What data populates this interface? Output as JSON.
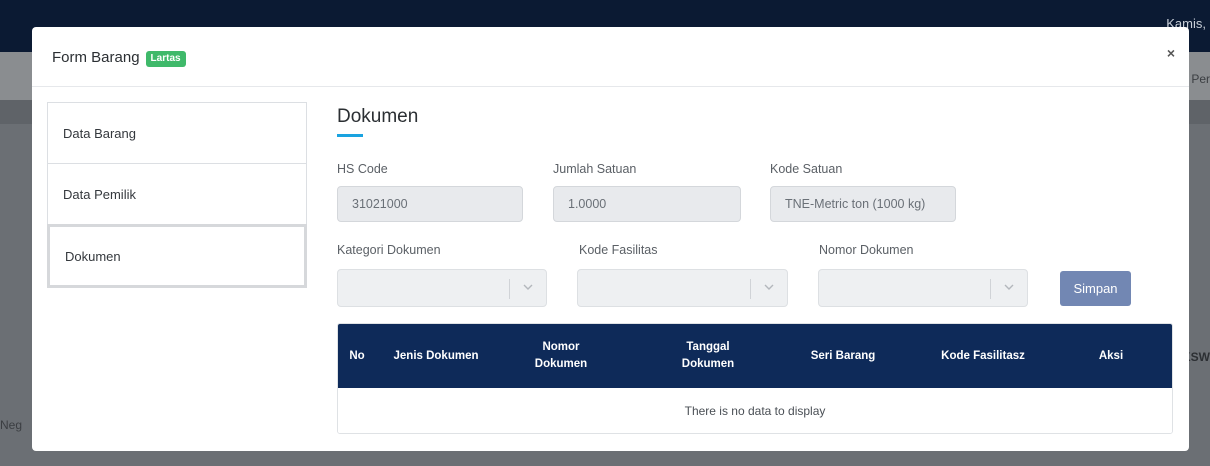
{
  "background": {
    "topbar_text": "Kamis,",
    "subbar_text": "Per",
    "right_side_text": "KSW",
    "left_side_text": "Neg"
  },
  "modal": {
    "title": "Form Barang",
    "badge": "Lartas",
    "close": "×"
  },
  "nav": {
    "items": [
      {
        "label": "Data Barang"
      },
      {
        "label": "Data Pemilik"
      },
      {
        "label": "Dokumen"
      }
    ],
    "active": "Dokumen"
  },
  "section": {
    "title": "Dokumen"
  },
  "fields": {
    "hs_code": {
      "label": "HS Code",
      "value": "31021000"
    },
    "jumlah_satuan": {
      "label": "Jumlah Satuan",
      "value": "1.0000"
    },
    "kode_satuan": {
      "label": "Kode Satuan",
      "value": "TNE-Metric ton (1000 kg)"
    },
    "kategori_dokumen": {
      "label": "Kategori Dokumen",
      "value": ""
    },
    "kode_fasilitas": {
      "label": "Kode Fasilitas",
      "value": ""
    },
    "nomor_dokumen": {
      "label": "Nomor Dokumen",
      "value": ""
    }
  },
  "buttons": {
    "simpan": "Simpan"
  },
  "table": {
    "columns": {
      "no": "No",
      "jenis_dokumen": "Jenis Dokumen",
      "nomor_dokumen_1": "Nomor",
      "nomor_dokumen_2": "Dokumen",
      "tanggal_dokumen_1": "Tanggal",
      "tanggal_dokumen_2": "Dokumen",
      "seri_barang": "Seri Barang",
      "kode_fasilitasz": "Kode Fasilitasz",
      "aksi": "Aksi"
    },
    "empty_message": "There is no data to display"
  },
  "colors": {
    "badge": "#3fb96a",
    "table_header": "#0e2a59",
    "accent_underline": "#1aa3e0",
    "button": "#7287b3"
  }
}
